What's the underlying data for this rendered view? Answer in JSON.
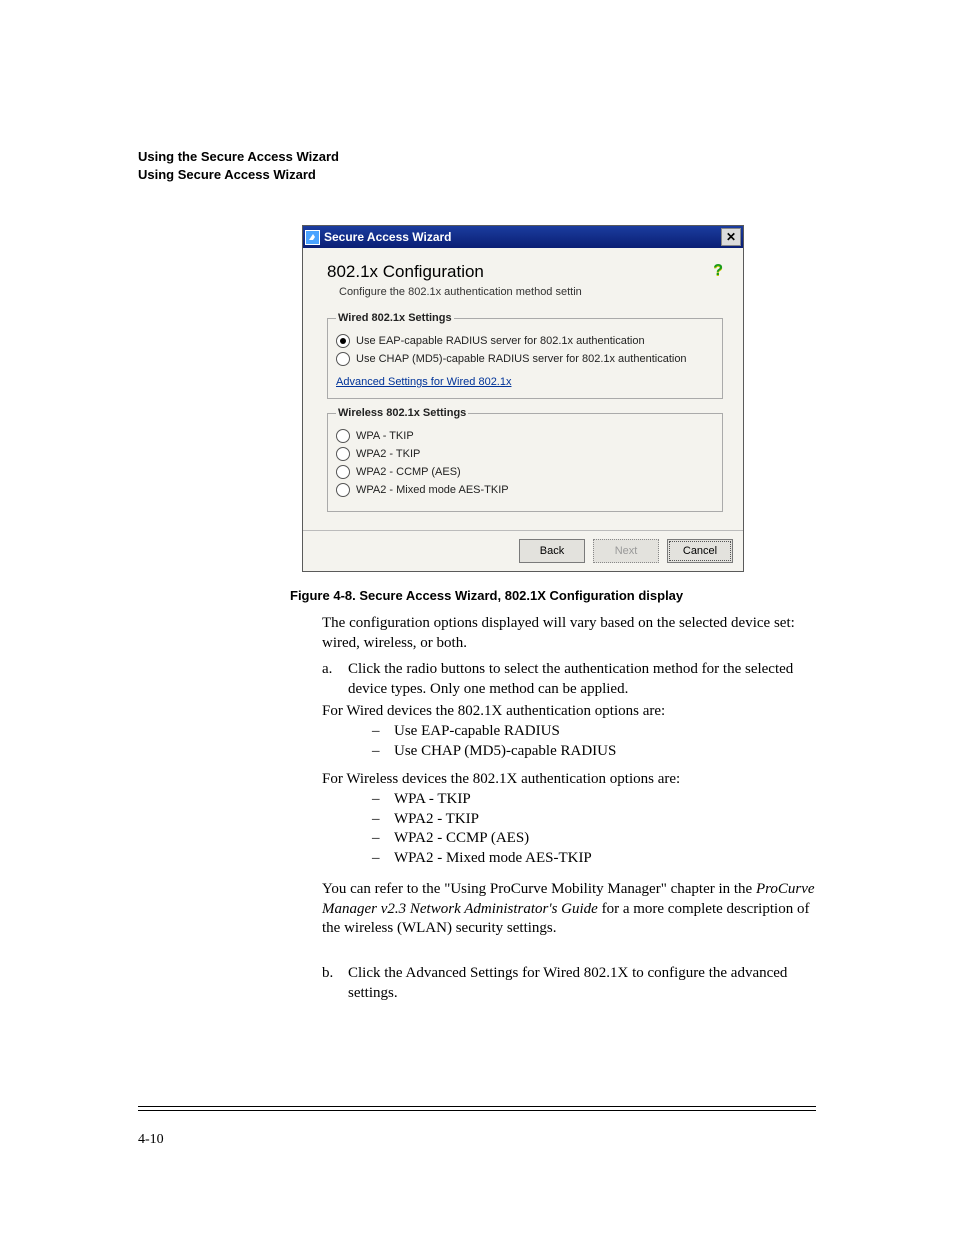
{
  "header": {
    "line1": "Using the Secure Access Wizard",
    "line2": "Using Secure Access Wizard"
  },
  "wizard": {
    "window_title": "Secure Access Wizard",
    "title": "802.1x Configuration",
    "subtitle": "Configure the 802.1x authentication method settin",
    "wired_legend": "Wired 802.1x Settings",
    "wired_options": [
      "Use EAP-capable RADIUS server for 802.1x authentication",
      "Use CHAP (MD5)-capable RADIUS server for 802.1x authentication"
    ],
    "link": "Advanced Settings for Wired 802.1x",
    "wireless_legend": "Wireless 802.1x Settings",
    "wireless_options": [
      "WPA - TKIP",
      "WPA2 - TKIP",
      "WPA2 - CCMP (AES)",
      "WPA2 - Mixed mode AES-TKIP"
    ],
    "buttons": {
      "back": "Back",
      "next": "Next",
      "cancel": "Cancel"
    }
  },
  "figure_caption": "Figure 4-8. Secure Access Wizard, 802.1X Configuration display",
  "body": {
    "p1": "The configuration options displayed will vary based on the selected device set: wired, wireless, or both.",
    "a_marker": "a.",
    "a_text": "Click the radio buttons to select the authentication method for the selected device types. Only one method can be applied.",
    "p2": "For Wired devices the 802.1X authentication options are:",
    "wired_list": [
      "Use EAP-capable RADIUS",
      "Use CHAP (MD5)-capable RADIUS"
    ],
    "p3": "For Wireless devices the 802.1X authentication options are:",
    "wireless_list": [
      "WPA - TKIP",
      "WPA2 - TKIP",
      "WPA2 - CCMP (AES)",
      "WPA2 - Mixed mode AES-TKIP"
    ],
    "p4_1": "You can refer to the \"Using ProCurve Mobility Manager\" chapter in the ",
    "p4_italic": "ProCurve Manager v2.3 Network Administrator's Guide",
    "p4_2": " for a more complete description of the wireless (WLAN) security settings.",
    "b_marker": "b.",
    "b_text": "Click the Advanced Settings for Wired 802.1X to configure the advanced settings."
  },
  "page_number": "4-10"
}
